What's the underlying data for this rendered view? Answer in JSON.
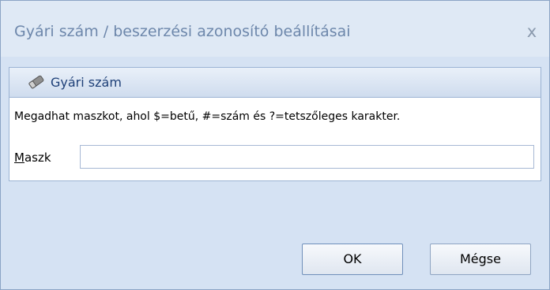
{
  "window": {
    "title": "Gyári szám / beszerzési azonosító beállításai",
    "close_glyph": "x",
    "close_icon": "close-icon"
  },
  "group": {
    "icon": "eraser-icon",
    "title": "Gyári szám",
    "hint": "Megadhat maszkot, ahol $=betű, #=szám és ?=tetszőleges karakter."
  },
  "mask": {
    "label_mnemonic": "M",
    "label_rest": "aszk",
    "value": ""
  },
  "buttons": {
    "ok_label": "OK",
    "cancel_label": "Mégse"
  }
}
